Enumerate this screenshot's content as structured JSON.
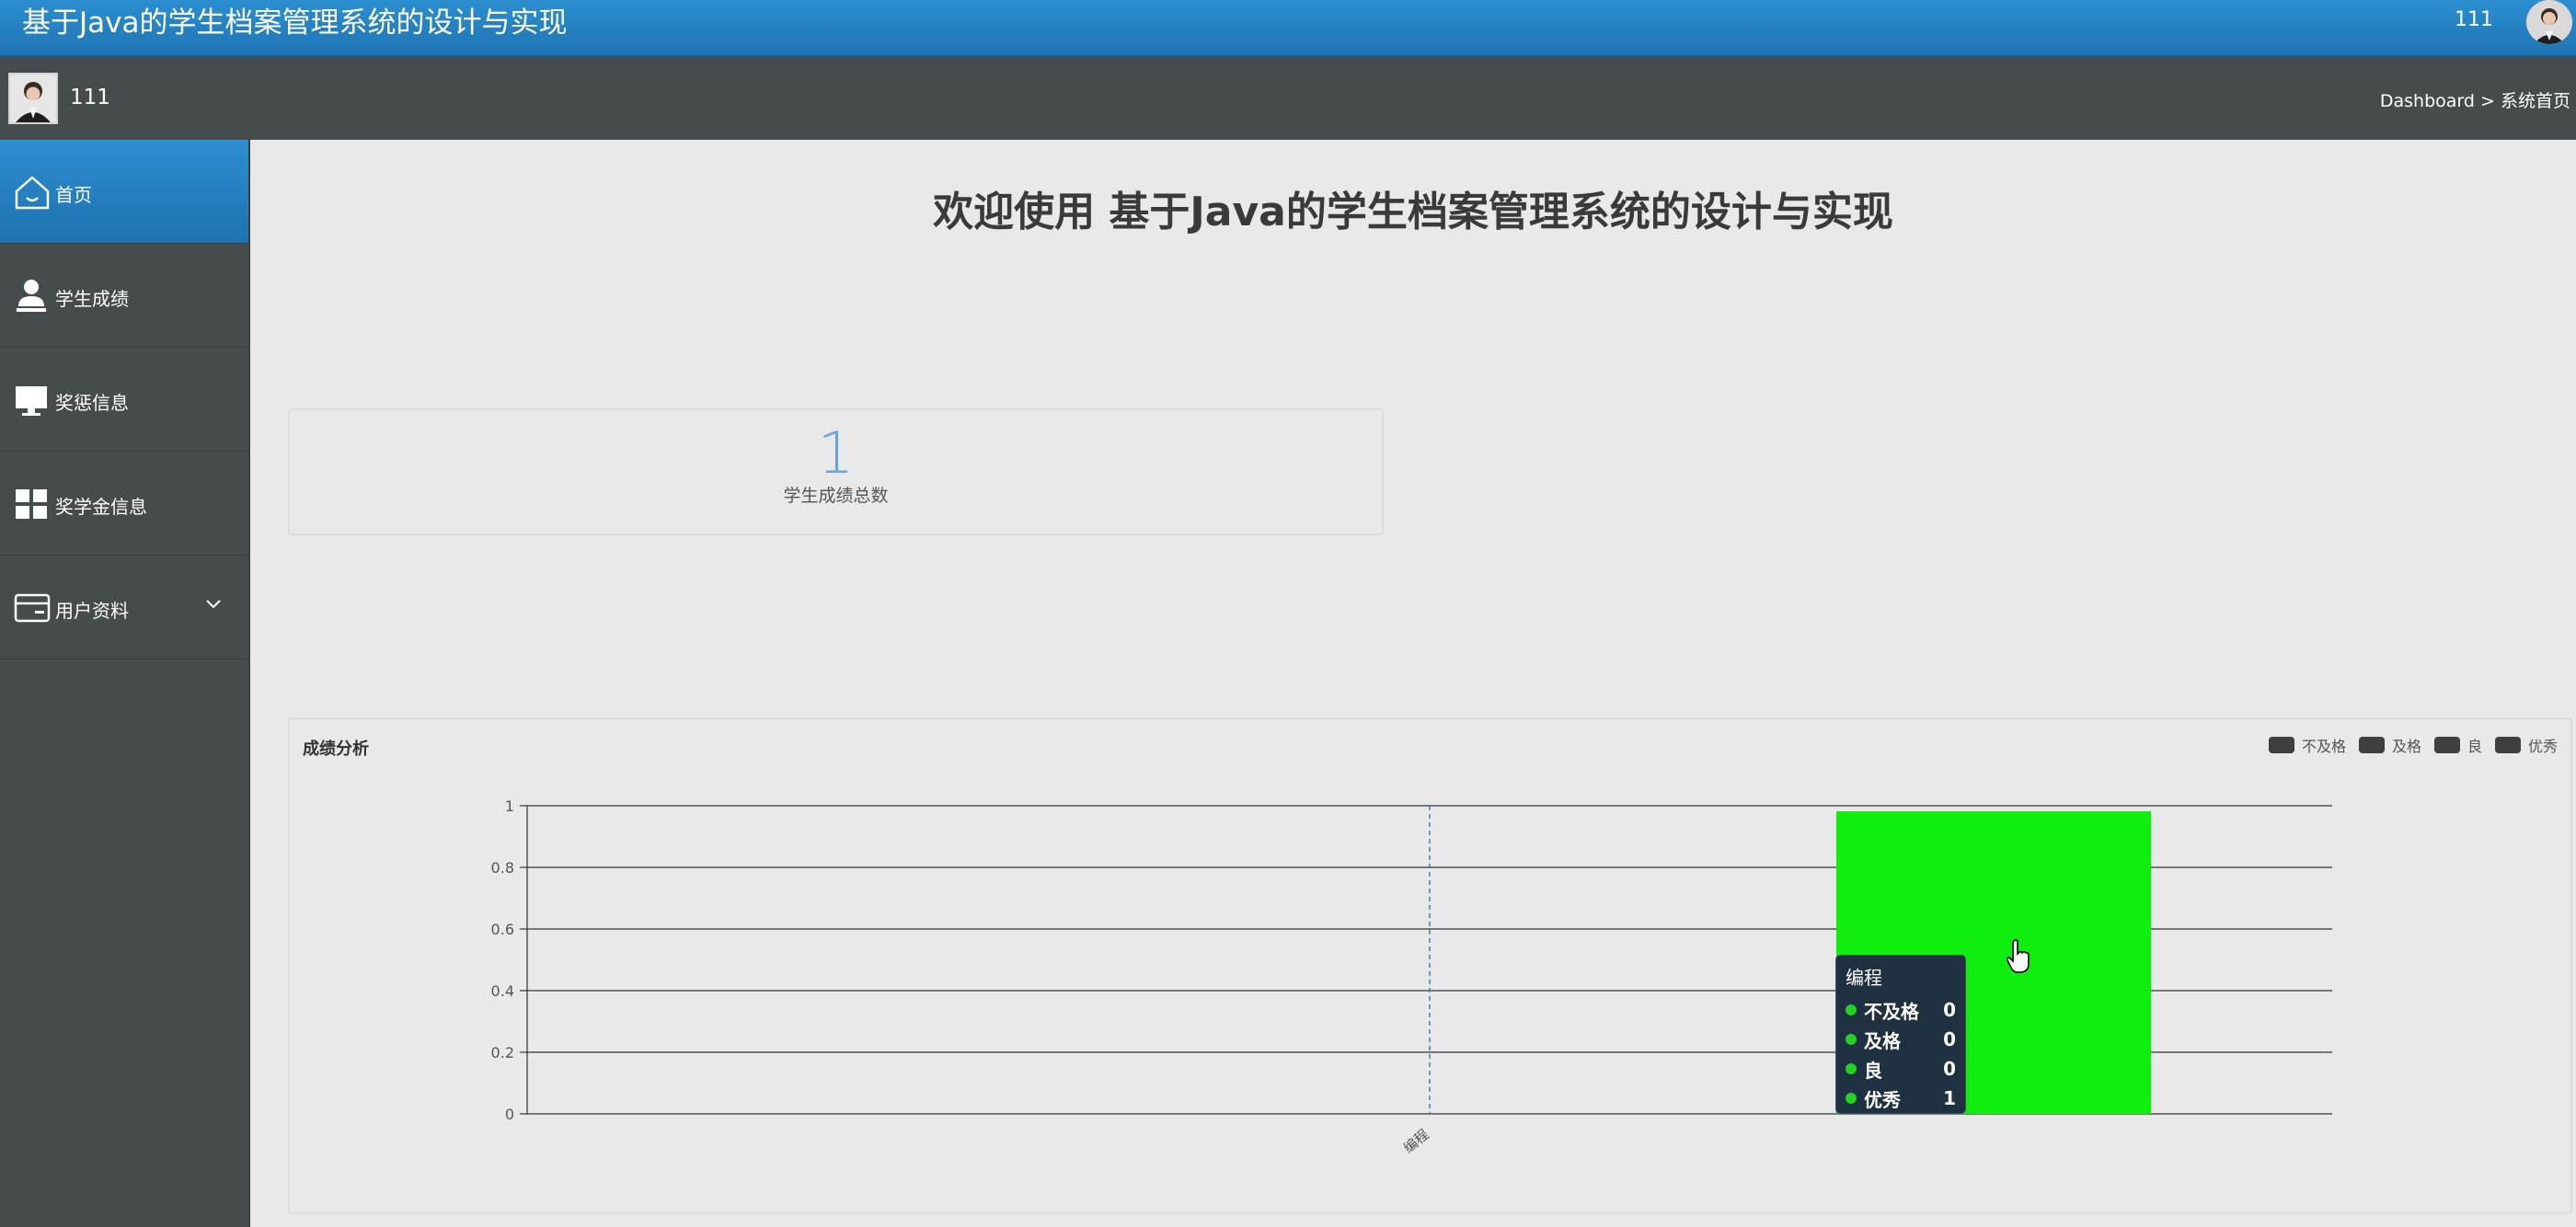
{
  "header": {
    "app_title": "基于Java的学生档案管理系统的设计与实现",
    "username": "111"
  },
  "subheader": {
    "username": "111",
    "breadcrumb": [
      "Dashboard",
      "系统首页"
    ],
    "breadcrumb_sep": ">"
  },
  "sidebar": {
    "items": [
      {
        "label": "首页",
        "icon": "home-icon",
        "active": true
      },
      {
        "label": "学生成绩",
        "icon": "user-icon",
        "active": false
      },
      {
        "label": "奖惩信息",
        "icon": "monitor-icon",
        "active": false
      },
      {
        "label": "奖学金信息",
        "icon": "grid-icon",
        "active": false
      },
      {
        "label": "用户资料",
        "icon": "card-icon",
        "active": false,
        "has_submenu": true
      }
    ]
  },
  "main": {
    "welcome": "欢迎使用 基于Java的学生档案管理系统的设计与实现",
    "stat": {
      "value": "1",
      "label": "学生成绩总数"
    },
    "chart_title": "成绩分析"
  },
  "chart_data": {
    "type": "bar",
    "title": "成绩分析",
    "categories": [
      "编程"
    ],
    "series": [
      {
        "name": "不及格",
        "values": [
          0
        ]
      },
      {
        "name": "及格",
        "values": [
          0
        ]
      },
      {
        "name": "良",
        "values": [
          0
        ]
      },
      {
        "name": "优秀",
        "values": [
          1
        ]
      }
    ],
    "ylim": [
      0,
      1
    ],
    "yticks": [
      "0",
      "0.2",
      "0.4",
      "0.6",
      "0.8",
      "1"
    ],
    "grid": true,
    "legend": "top-right",
    "legend_swatch_color": "#3f3f3f",
    "bar_color": "#10ee10"
  },
  "tooltip": {
    "title": "编程",
    "rows": [
      {
        "name": "不及格",
        "value": "0"
      },
      {
        "name": "及格",
        "value": "0"
      },
      {
        "name": "良",
        "value": "0"
      },
      {
        "name": "优秀",
        "value": "1"
      }
    ]
  },
  "colors": {
    "header_blue": "#2384c6",
    "sidebar_dark": "#464c4e",
    "stat_blue": "#6aa3d8",
    "tooltip_bg": "#1f3141"
  }
}
